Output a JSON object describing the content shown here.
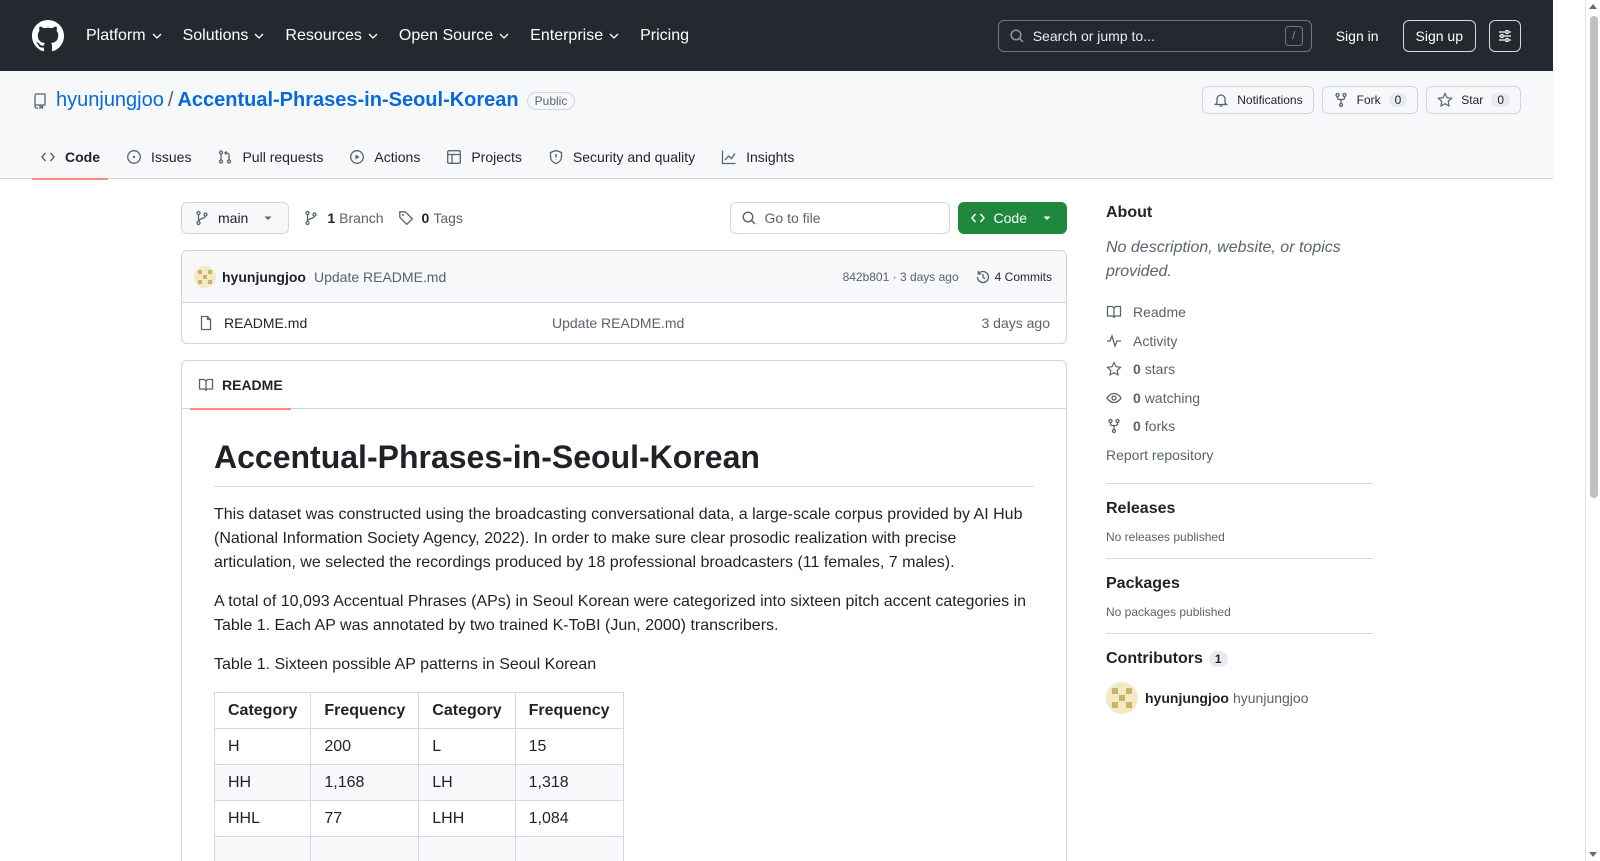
{
  "header": {
    "nav": [
      "Platform",
      "Solutions",
      "Resources",
      "Open Source",
      "Enterprise",
      "Pricing"
    ],
    "search_placeholder": "Search or jump to...",
    "search_key": "/",
    "signin": "Sign in",
    "signup": "Sign up"
  },
  "repo": {
    "owner": "hyunjungjoo",
    "sep": "/",
    "name": "Accentual-Phrases-in-Seoul-Korean",
    "visibility": "Public",
    "notifications": "Notifications",
    "fork_label": "Fork",
    "fork_count": "0",
    "star_label": "Star",
    "star_count": "0",
    "tabs": [
      "Code",
      "Issues",
      "Pull requests",
      "Actions",
      "Projects",
      "Security and quality",
      "Insights"
    ]
  },
  "toolbar": {
    "branch": "main",
    "branch_count": "1",
    "branch_label": "Branch",
    "tag_count": "0",
    "tag_label": "Tags",
    "goto_placeholder": "Go to file",
    "code_label": "Code"
  },
  "commit": {
    "author": "hyunjungjoo",
    "message": "Update README.md",
    "hash_time": "842b801 · 3 days ago",
    "commits": "4 Commits"
  },
  "files": [
    {
      "name": "README.md",
      "message": "Update README.md",
      "time": "3 days ago"
    }
  ],
  "readme": {
    "tab": "README",
    "title": "Accentual-Phrases-in-Seoul-Korean",
    "p1": "This dataset was constructed using the broadcasting conversational data, a large-scale corpus provided by AI Hub (National Information Society Agency, 2022). In order to make sure clear prosodic realization with precise articulation, we selected the recordings produced by 18 professional broadcasters (11 females, 7 males).",
    "p2": "A total of 10,093 Accentual Phrases (APs) in Seoul Korean were categorized into sixteen pitch accent categories in Table 1. Each AP was annotated by two trained K-ToBI (Jun, 2000) transcribers.",
    "caption": "Table 1. Sixteen possible AP patterns in Seoul Korean",
    "table_headers": [
      "Category",
      "Frequency",
      "Category",
      "Frequency"
    ],
    "table_rows": [
      [
        "H",
        "200",
        "L",
        "15"
      ],
      [
        "HH",
        "1,168",
        "LH",
        "1,318"
      ],
      [
        "HHL",
        "77",
        "LHH",
        "1,084"
      ]
    ]
  },
  "sidebar": {
    "about": "About",
    "description": "No description, website, or topics provided.",
    "links": {
      "readme": "Readme",
      "activity": "Activity",
      "stars_count": "0",
      "stars": "stars",
      "watching_count": "0",
      "watching": "watching",
      "forks_count": "0",
      "forks": "forks",
      "report": "Report repository"
    },
    "releases": "Releases",
    "releases_none": "No releases published",
    "packages": "Packages",
    "packages_none": "No packages published",
    "contributors": "Contributors",
    "contributors_count": "1",
    "contributor_login": "hyunjungjoo",
    "contributor_name": "hyunjungjoo"
  },
  "colors": {
    "header_bg": "#24292f",
    "link": "#0969da",
    "code_button": "#1f883d",
    "tab_underline": "#fd8c73"
  }
}
